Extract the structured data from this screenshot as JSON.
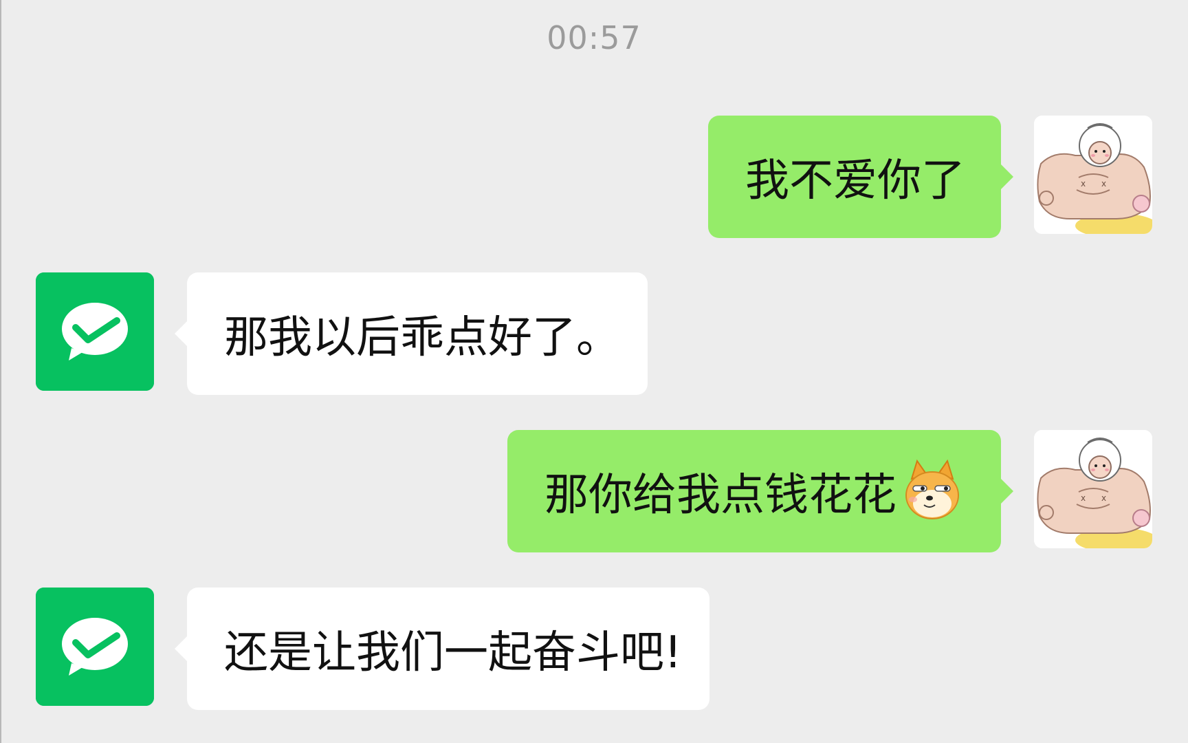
{
  "chat": {
    "timestamp": "00:57",
    "messages": [
      {
        "sender": "me",
        "text": "我不爱你了"
      },
      {
        "sender": "bot",
        "text": "那我以后乖点好了。"
      },
      {
        "sender": "me",
        "text": "那你给我点钱花花",
        "emoji": "shiba-dog-emoji"
      },
      {
        "sender": "bot",
        "text": "还是让我们一起奋斗吧!"
      }
    ]
  },
  "avatars": {
    "me": "muscular-sheep-cartoon-avatar",
    "bot": "wechat-logo-avatar"
  },
  "colors": {
    "background": "#ededed",
    "sent_bubble": "#95ec69",
    "received_bubble": "#ffffff",
    "wechat_green": "#07c160"
  }
}
